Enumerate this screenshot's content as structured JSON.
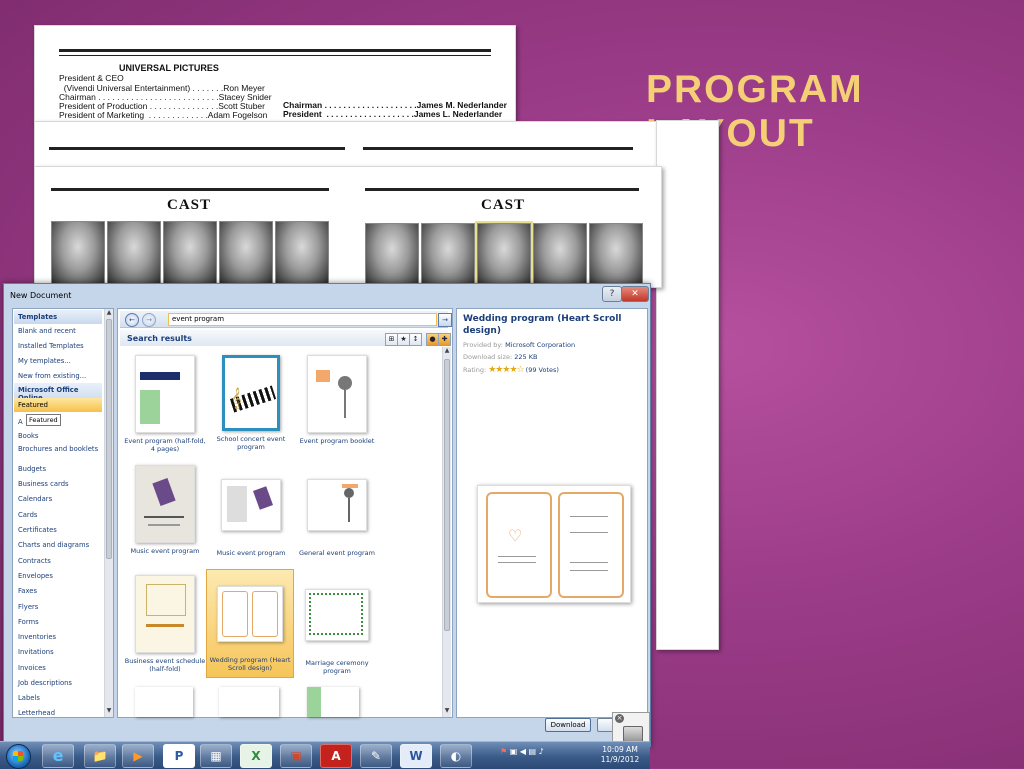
{
  "slide": {
    "title": "PROGRAM LAYOUT"
  },
  "program_doc": {
    "studio": "UNIVERSAL PICTURES",
    "lines": [
      "President & CEO",
      "  (Vivendi Universal Entertainment) . . . . . . .Ron Meyer",
      "Chairman . . . . . . . . . . . . . . . . . . . . . . . . . .Stacey Snider",
      "President of Production . . . . . . . . . . . . . . .Scott Stuber",
      "President of Marketing  . . . . . . . . . . . . .Adam Fogelson"
    ],
    "right_lines": [
      "Chairman . . . . . . . . . . . . . . . . . . . .James M. Nederlander",
      "President  . . . . . . . . . . . . . . . . . . .James L. Nederlander"
    ],
    "cast_left": "CAST",
    "cast_right": "CAST"
  },
  "dialog": {
    "title": "New Document",
    "help": "?",
    "close": "✕",
    "categories": [
      {
        "label": "Templates",
        "type": "header"
      },
      {
        "label": "Blank and recent"
      },
      {
        "label": "Installed Templates"
      },
      {
        "label": "My templates..."
      },
      {
        "label": "New from existing..."
      },
      {
        "label": "Microsoft Office Online",
        "type": "header"
      },
      {
        "label": "Featured",
        "type": "selected"
      },
      {
        "label": "A"
      },
      {
        "label": "Books"
      },
      {
        "label": "Brochures and booklets"
      },
      {
        "label": "Budgets"
      },
      {
        "label": "Business cards"
      },
      {
        "label": "Calendars"
      },
      {
        "label": "Cards"
      },
      {
        "label": "Certificates"
      },
      {
        "label": "Charts and diagrams"
      },
      {
        "label": "Contracts"
      },
      {
        "label": "Envelopes"
      },
      {
        "label": "Faxes"
      },
      {
        "label": "Flyers"
      },
      {
        "label": "Forms"
      },
      {
        "label": "Inventories"
      },
      {
        "label": "Invitations"
      },
      {
        "label": "Invoices"
      },
      {
        "label": "Job descriptions"
      },
      {
        "label": "Labels"
      },
      {
        "label": "Letterhead"
      }
    ],
    "tooltip": "Featured",
    "search": {
      "value": "event program",
      "back": "←",
      "forward": "→",
      "go": "→"
    },
    "results_title": "Search results",
    "templates": [
      {
        "caption": "Event program (half-fold, 4 pages)"
      },
      {
        "caption": "School concert event program"
      },
      {
        "caption": "Event program booklet"
      },
      {
        "caption": "Music event program"
      },
      {
        "caption": "Music event program"
      },
      {
        "caption": "General event program"
      },
      {
        "caption": "Business event schedule (half-fold)"
      },
      {
        "caption": "Wedding program (Heart Scroll design)",
        "selected": true
      },
      {
        "caption": "Marriage ceremony program"
      }
    ],
    "detail": {
      "title": "Wedding program (Heart Scroll design)",
      "provided_label": "Provided by:",
      "provided_value": "Microsoft Corporation",
      "size_label": "Download size:",
      "size_value": "225 KB",
      "rating_label": "Rating:",
      "rating_stars": "★★★★☆",
      "rating_value": 4,
      "votes": "(99 Votes)"
    },
    "download_label": "Download"
  },
  "taskbar": {
    "apps": [
      "e",
      "📁",
      "▶",
      "P",
      "▦",
      "X",
      "▣",
      "A",
      "✎",
      "W",
      "◐"
    ],
    "time": "10:09 AM",
    "date": "11/9/2012"
  },
  "colors": {
    "accent": "#f4cf76",
    "background": "#9a3b87",
    "link": "#1b3f7a"
  }
}
